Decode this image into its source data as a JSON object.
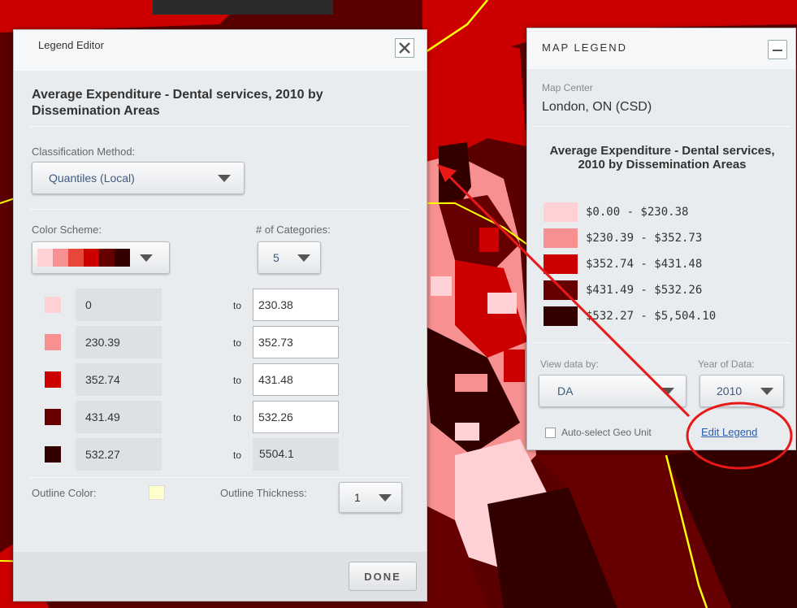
{
  "colors": {
    "class1": "#ffd1d4",
    "class2": "#f79191",
    "class3": "#cc0000",
    "class4": "#660000",
    "class5": "#330000",
    "outline": "#ffffcc",
    "annotation": "#e81818"
  },
  "editor": {
    "title": "Legend Editor",
    "heading": "Average Expenditure - Dental services, 2010 by Dissemination Areas",
    "classification_label": "Classification Method:",
    "classification_value": "Quantiles (Local)",
    "color_scheme_label": "Color Scheme:",
    "categories_label": "# of Categories:",
    "categories_value": "5",
    "to_label": "to",
    "rows": [
      {
        "from": "0",
        "to": "230.38"
      },
      {
        "from": "230.39",
        "to": "352.73"
      },
      {
        "from": "352.74",
        "to": "431.48"
      },
      {
        "from": "431.49",
        "to": "532.26"
      },
      {
        "from": "532.27",
        "to": "5504.1"
      }
    ],
    "outline_color_label": "Outline Color:",
    "outline_thickness_label": "Outline Thickness:",
    "outline_thickness_value": "1",
    "done_label": "DONE"
  },
  "legend": {
    "title": "MAP LEGEND",
    "center_label": "Map Center",
    "center_value": "London, ON (CSD)",
    "heading": "Average Expenditure - Dental services, 2010 by Dissemination Areas",
    "items": [
      "$0.00 - $230.38",
      "$230.39 - $352.73",
      "$352.74 - $431.48",
      "$431.49 - $532.26",
      "$532.27 - $5,504.10"
    ],
    "view_by_label": "View data by:",
    "view_by_value": "DA",
    "year_label": "Year of Data:",
    "year_value": "2010",
    "auto_select_label": "Auto-select Geo Unit",
    "edit_link": "Edit Legend"
  }
}
